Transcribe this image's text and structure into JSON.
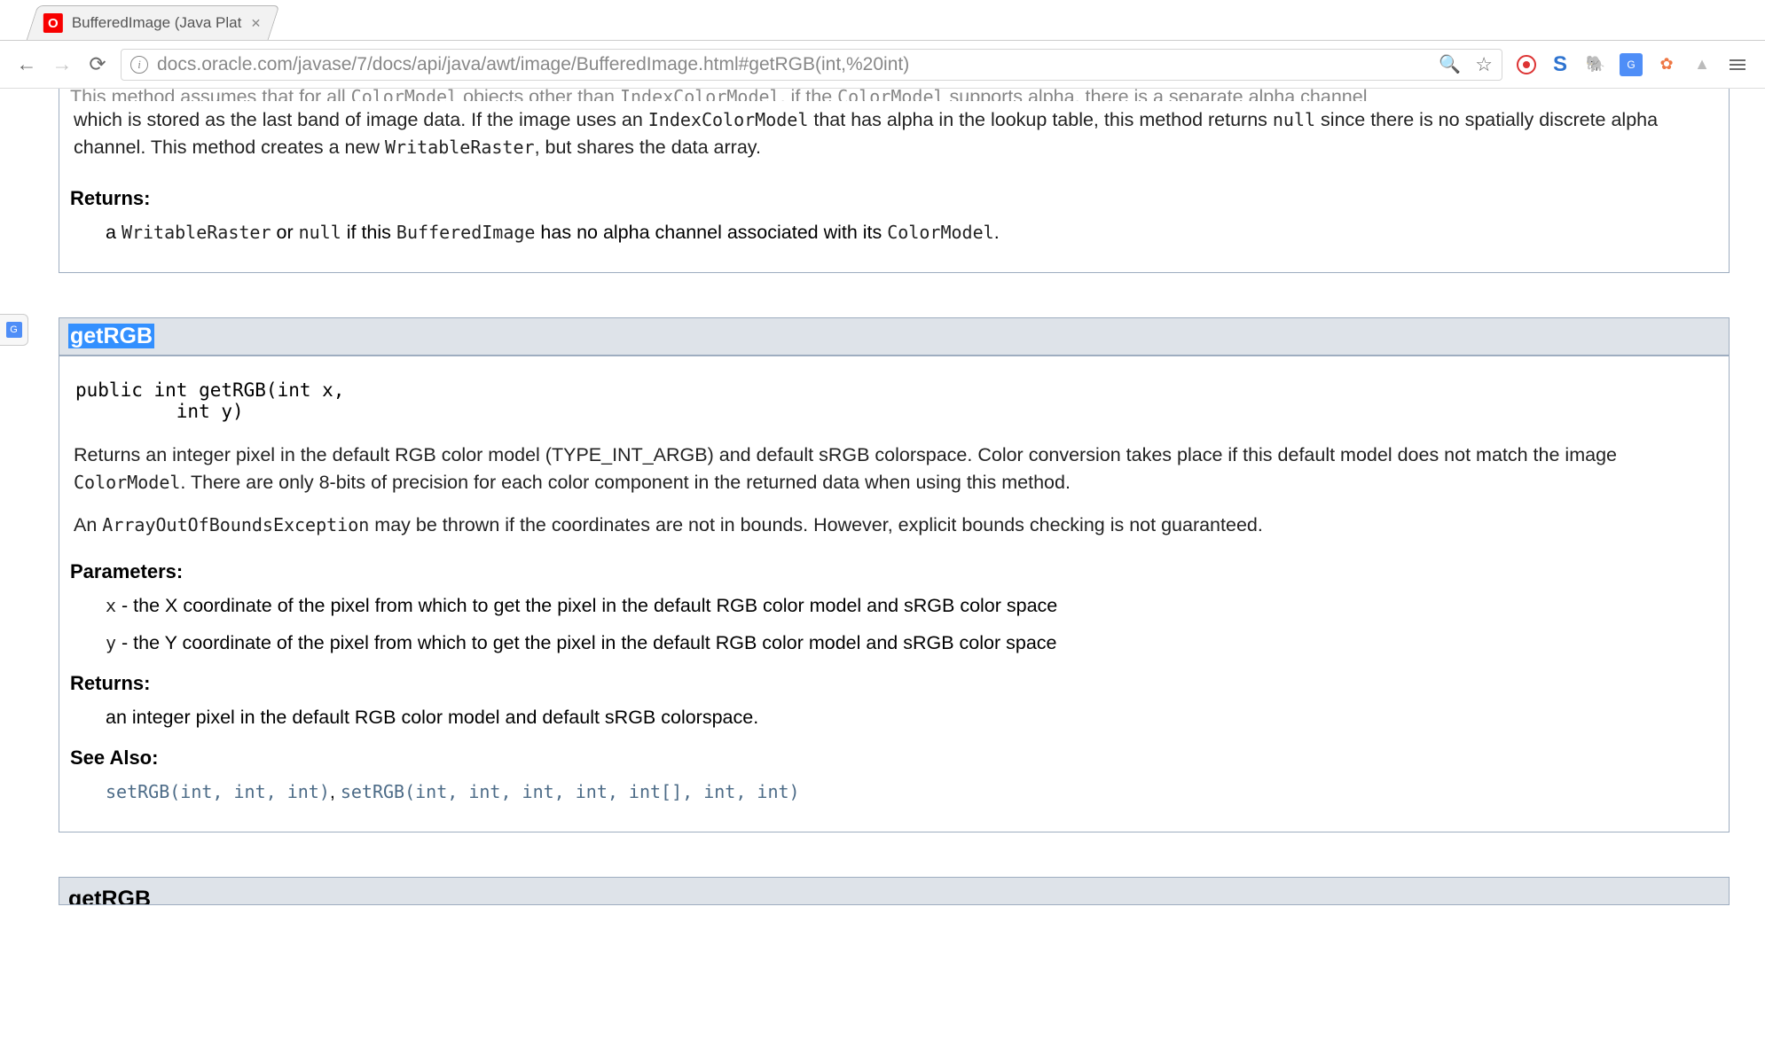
{
  "browser": {
    "tab_title": "BufferedImage (Java Plat",
    "tab_favicon_letter": "O",
    "url": "docs.oracle.com/javase/7/docs/api/java/awt/image/BufferedImage.html#getRGB(int,%20int)"
  },
  "top_block": {
    "cut_line1_a": "This method assumes that for all ",
    "cut_line1_b": "ColorModel",
    "cut_line1_c": " objects other than ",
    "cut_line1_d": "IndexColorModel",
    "cut_line1_e": ", if the ",
    "cut_line1_f": "ColorModel",
    "cut_line1_g": " supports alpha, there is a separate alpha channel",
    "line2_a": "which is stored as the last band of image data. If the image uses an ",
    "line2_b": "IndexColorModel",
    "line2_c": " that has alpha in the lookup table, this method returns ",
    "line2_d": "null",
    "line2_e": " since there is no spatially discrete alpha channel. This method creates a new ",
    "line2_f": "WritableRaster",
    "line2_g": ", but shares the data array.",
    "returns_label": "Returns:",
    "returns_a": "a ",
    "returns_b": "WritableRaster",
    "returns_c": " or ",
    "returns_d": "null",
    "returns_e": " if this ",
    "returns_f": "BufferedImage",
    "returns_g": " has no alpha channel associated with its ",
    "returns_h": "ColorModel",
    "returns_i": "."
  },
  "method1": {
    "name": "getRGB",
    "signature": "public int getRGB(int x,\n         int y)",
    "desc1_a": "Returns an integer pixel in the default RGB color model (TYPE_INT_ARGB) and default sRGB colorspace. Color conversion takes place if this default model does not match the image ",
    "desc1_b": "ColorModel",
    "desc1_c": ". There are only 8-bits of precision for each color component in the returned data when using this method.",
    "desc2_a": "An ",
    "desc2_b": "ArrayOutOfBoundsException",
    "desc2_c": " may be thrown if the coordinates are not in bounds. However, explicit bounds checking is not guaranteed.",
    "params_label": "Parameters:",
    "param_x_a": "x",
    "param_x_b": " - the X coordinate of the pixel from which to get the pixel in the default RGB color model and sRGB color space",
    "param_y_a": "y",
    "param_y_b": " - the Y coordinate of the pixel from which to get the pixel in the default RGB color model and sRGB color space",
    "returns_label": "Returns:",
    "returns_text": "an integer pixel in the default RGB color model and default sRGB colorspace.",
    "seealso_label": "See Also:",
    "seealso_1": "setRGB(int, int, int)",
    "seealso_sep": ", ",
    "seealso_2": "setRGB(int, int, int, int, int[], int, int)"
  },
  "method2": {
    "name_partial": "getRGB"
  }
}
